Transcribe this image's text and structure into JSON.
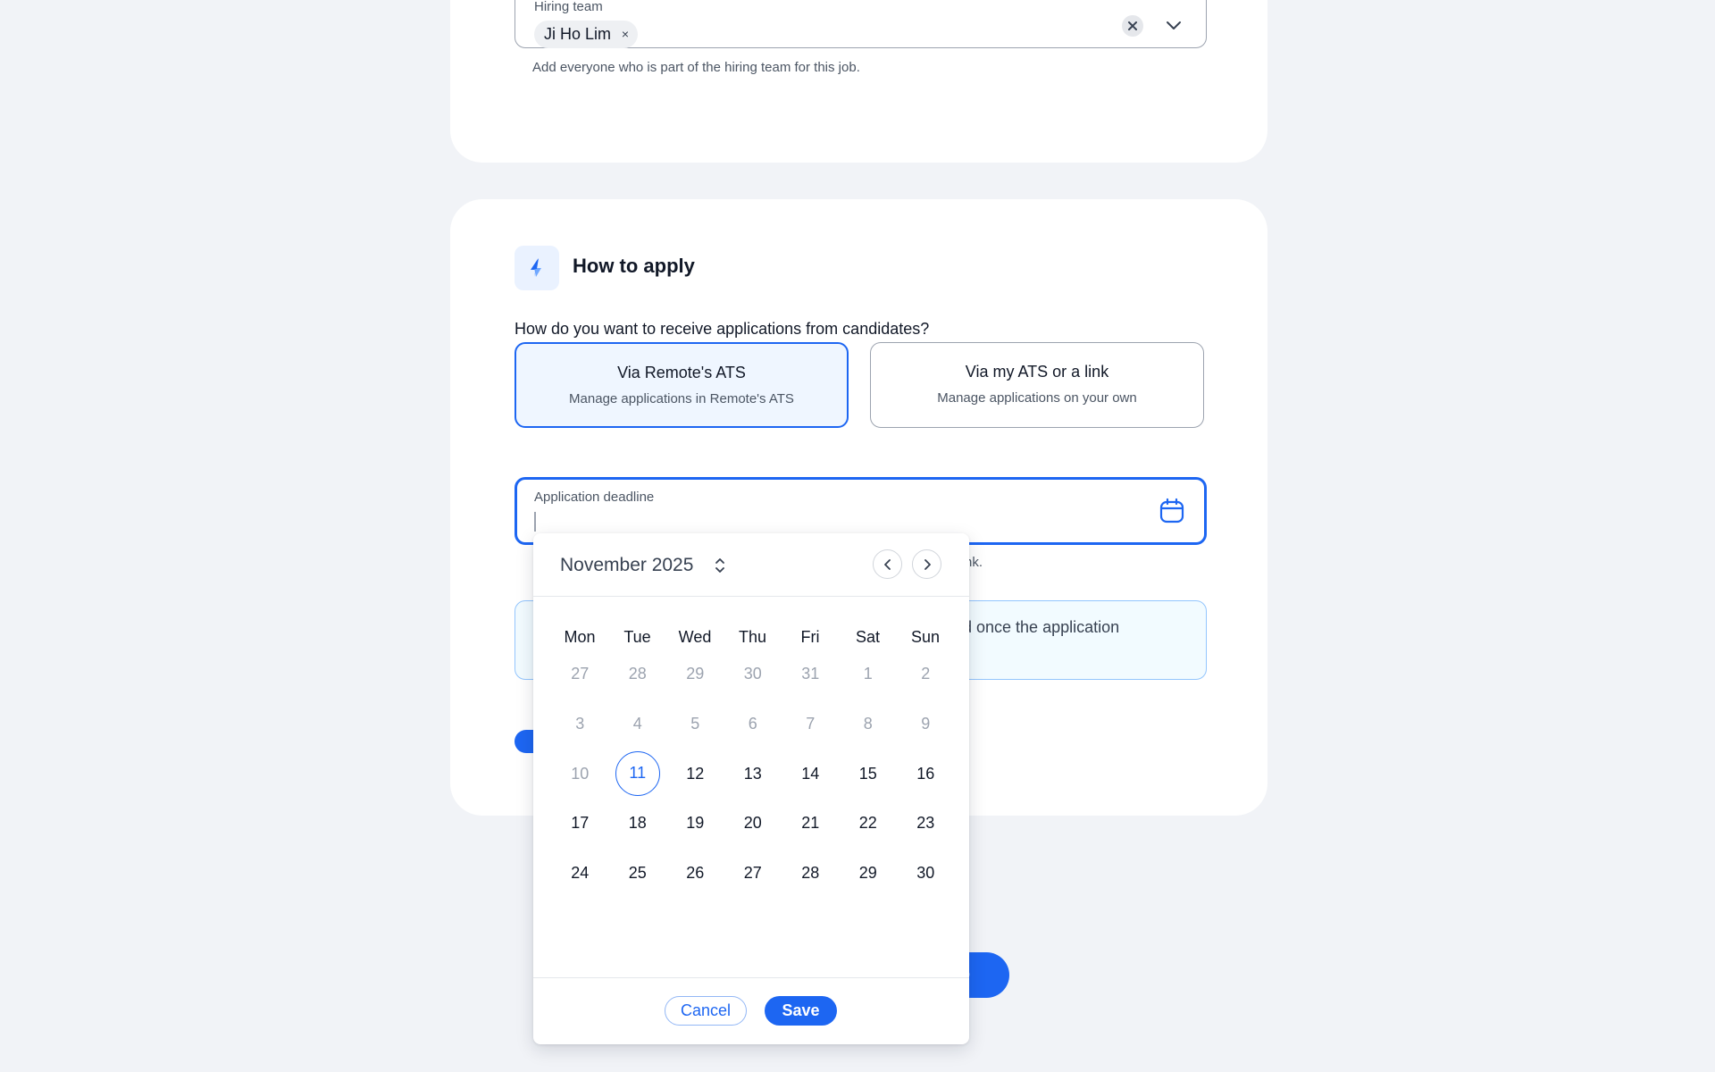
{
  "hiring_team": {
    "label": "Hiring team",
    "chips": [
      "Ji Ho Lim"
    ],
    "chip_remove": "×",
    "help": "Add everyone who is part of the hiring team for this job."
  },
  "how_to_apply": {
    "icon": "bolt-icon",
    "title": "How to apply",
    "question": "How do you want to receive applications from candidates?",
    "options": [
      {
        "title": "Via Remote's ATS",
        "desc": "Manage applications in Remote's ATS",
        "selected": true
      },
      {
        "title": "Via my ATS or a link",
        "desc": "Manage applications on your own",
        "selected": false
      }
    ],
    "deadline": {
      "label": "Application deadline",
      "value": "",
      "help_visible_tail": "nk."
    },
    "info_visible_tail": "rd once the application"
  },
  "footer_button_visible_tail": "b",
  "date_picker": {
    "month_label": "November 2025",
    "weekdays": [
      "Mon",
      "Tue",
      "Wed",
      "Thu",
      "Fri",
      "Sat",
      "Sun"
    ],
    "weeks": [
      [
        "27",
        "28",
        "29",
        "30",
        "31",
        "1",
        "2"
      ],
      [
        "3",
        "4",
        "5",
        "6",
        "7",
        "8",
        "9"
      ],
      [
        "10",
        "11",
        "12",
        "13",
        "14",
        "15",
        "16"
      ],
      [
        "17",
        "18",
        "19",
        "20",
        "21",
        "22",
        "23"
      ],
      [
        "24",
        "25",
        "26",
        "27",
        "28",
        "29",
        "30"
      ]
    ],
    "muted_days": [
      [
        true,
        true,
        true,
        true,
        true,
        true,
        true
      ],
      [
        true,
        true,
        true,
        true,
        true,
        true,
        true
      ],
      [
        true,
        false,
        false,
        false,
        false,
        false,
        false
      ],
      [
        false,
        false,
        false,
        false,
        false,
        false,
        false
      ],
      [
        false,
        false,
        false,
        false,
        false,
        false,
        false
      ]
    ],
    "today": "11",
    "cancel_label": "Cancel",
    "save_label": "Save"
  },
  "colors": {
    "accent": "#1d66f2",
    "background": "#f1f3f7",
    "muted_text": "#9ca3af",
    "info_bg": "#f2fbff"
  }
}
